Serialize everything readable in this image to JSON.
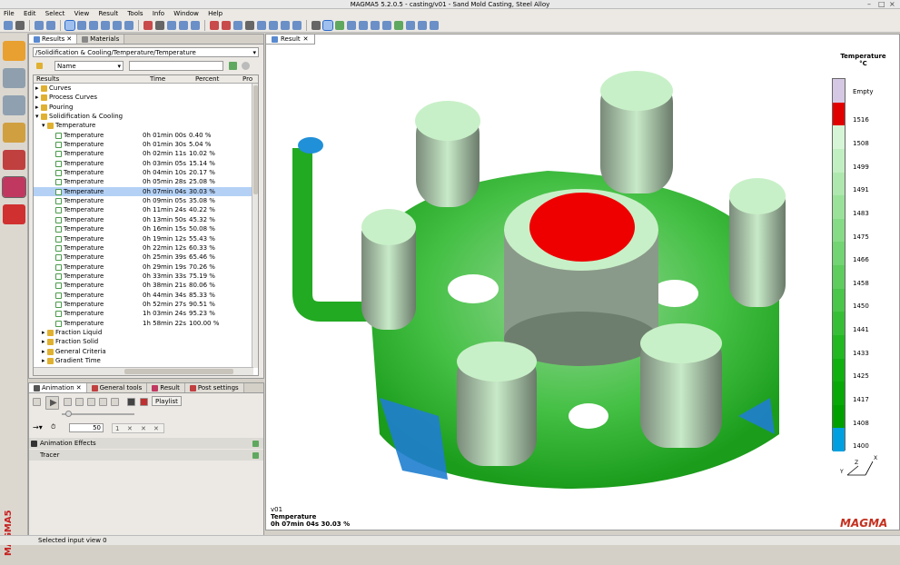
{
  "window": {
    "title": "MAGMA5 5.2.0.5 - casting/v01 - Sand Mold Casting, Steel Alloy"
  },
  "menu": [
    "File",
    "Edit",
    "Select",
    "View",
    "Result",
    "Tools",
    "Info",
    "Window",
    "Help"
  ],
  "results_panel": {
    "tabs": [
      "Results",
      "Materials"
    ],
    "path": "/Solidification & Cooling/Temperature/Temperature",
    "sort_field": "Name",
    "filter_value": "",
    "columns": [
      "Results",
      "Time",
      "Percent",
      "Pro"
    ],
    "tree_top": [
      "Curves",
      "Process Curves",
      "Pouring",
      "Solidification & Cooling",
      "Temperature"
    ],
    "rows": [
      {
        "name": "Temperature",
        "time": "0h 01min 00s",
        "percent": "0.40 %"
      },
      {
        "name": "Temperature",
        "time": "0h 01min 30s",
        "percent": "5.04 %"
      },
      {
        "name": "Temperature",
        "time": "0h 02min 11s",
        "percent": "10.02 %"
      },
      {
        "name": "Temperature",
        "time": "0h 03min 05s",
        "percent": "15.14 %"
      },
      {
        "name": "Temperature",
        "time": "0h 04min 10s",
        "percent": "20.17 %"
      },
      {
        "name": "Temperature",
        "time": "0h 05min 28s",
        "percent": "25.08 %"
      },
      {
        "name": "Temperature",
        "time": "0h 07min 04s",
        "percent": "30.03 %",
        "selected": true
      },
      {
        "name": "Temperature",
        "time": "0h 09min 05s",
        "percent": "35.08 %"
      },
      {
        "name": "Temperature",
        "time": "0h 11min 24s",
        "percent": "40.22 %"
      },
      {
        "name": "Temperature",
        "time": "0h 13min 50s",
        "percent": "45.32 %"
      },
      {
        "name": "Temperature",
        "time": "0h 16min 15s",
        "percent": "50.08 %"
      },
      {
        "name": "Temperature",
        "time": "0h 19min 12s",
        "percent": "55.43 %"
      },
      {
        "name": "Temperature",
        "time": "0h 22min 12s",
        "percent": "60.33 %"
      },
      {
        "name": "Temperature",
        "time": "0h 25min 39s",
        "percent": "65.46 %"
      },
      {
        "name": "Temperature",
        "time": "0h 29min 19s",
        "percent": "70.26 %"
      },
      {
        "name": "Temperature",
        "time": "0h 33min 33s",
        "percent": "75.19 %"
      },
      {
        "name": "Temperature",
        "time": "0h 38min 21s",
        "percent": "80.06 %"
      },
      {
        "name": "Temperature",
        "time": "0h 44min 34s",
        "percent": "85.33 %"
      },
      {
        "name": "Temperature",
        "time": "0h 52min 27s",
        "percent": "90.51 %"
      },
      {
        "name": "Temperature",
        "time": "1h 03min 24s",
        "percent": "95.23 %"
      },
      {
        "name": "Temperature",
        "time": "1h 58min 22s",
        "percent": "100.00 %"
      }
    ],
    "tree_bottom": [
      "Fraction Liquid",
      "Fraction Solid",
      "General Criteria",
      "Gradient Time"
    ]
  },
  "animation_panel": {
    "tabs": [
      "Animation",
      "General tools",
      "Result",
      "Post settings"
    ],
    "playlist_label": "Playlist",
    "fps": "50",
    "step": "1",
    "properties": [
      "Animation Effects",
      "Tracer"
    ]
  },
  "viewer": {
    "tab": "Result",
    "legend": {
      "title_line1": "Temperature",
      "title_line2": "°C",
      "empty_label": "Empty",
      "empty_color": "#d4c8e4",
      "labels": [
        "1516",
        "1508",
        "1499",
        "1491",
        "1483",
        "1475",
        "1466",
        "1458",
        "1450",
        "1441",
        "1433",
        "1425",
        "1417",
        "1408",
        "1400"
      ],
      "colors": [
        "#e00000",
        "#d6f5d6",
        "#c2efc2",
        "#aee8ae",
        "#9ae29a",
        "#86db86",
        "#72d472",
        "#5ecd5e",
        "#4ac64a",
        "#36bf36",
        "#22b822",
        "#10b010",
        "#08a808",
        "#00a000",
        "#00a0e0"
      ]
    },
    "info_line1": "v01",
    "info_line2": "Temperature",
    "info_line3": "0h 07min 04s 30.03 %",
    "brand": "MAGMA",
    "axis": [
      "Y",
      "Z",
      "X"
    ]
  },
  "status": "Selected input view 0"
}
